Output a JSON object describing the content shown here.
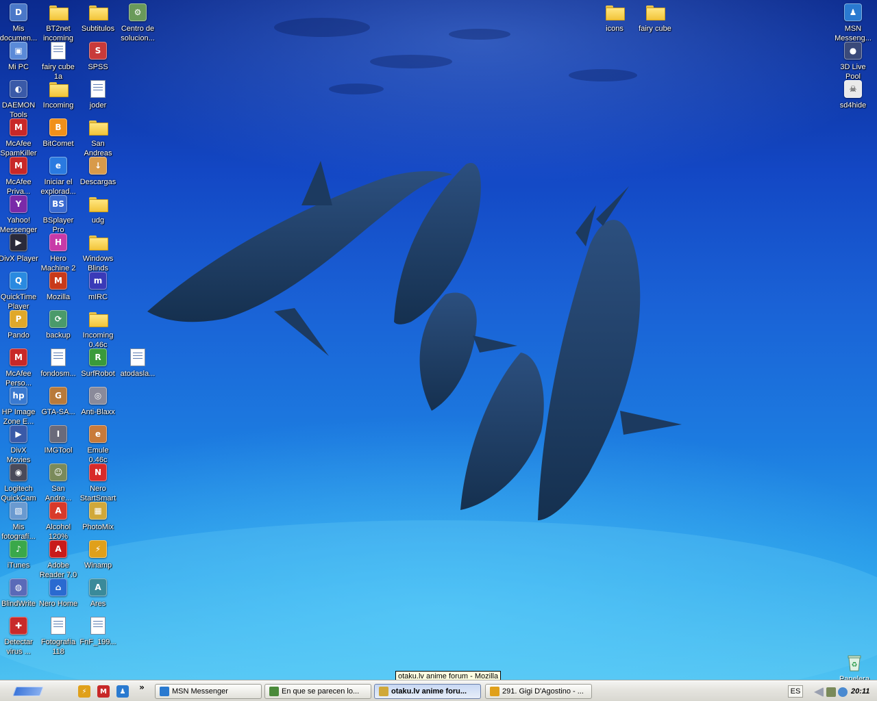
{
  "desktop": {
    "icons": [
      {
        "label": "Mis documen...",
        "kind": "app",
        "color": "#4a78c8",
        "glyph": "D"
      },
      {
        "label": "BT2net incoming",
        "kind": "folder"
      },
      {
        "label": "Subtitulos",
        "kind": "folder"
      },
      {
        "label": "Centro de solucion...",
        "kind": "app",
        "color": "#6a9a5a",
        "glyph": "⚙"
      },
      {
        "label": "Mi PC",
        "kind": "app",
        "color": "#5a8ad8",
        "glyph": "▣"
      },
      {
        "label": "fairy cube 1a",
        "kind": "doc"
      },
      {
        "label": "SPSS",
        "kind": "app",
        "color": "#c83a3a",
        "glyph": "S"
      },
      {
        "label": "DAEMON Tools",
        "kind": "app",
        "color": "#3a5aa8",
        "glyph": "◐"
      },
      {
        "label": "Incoming",
        "kind": "folder"
      },
      {
        "label": "joder",
        "kind": "doc"
      },
      {
        "label": "McAfee SpamKiller",
        "kind": "app",
        "color": "#c82828",
        "glyph": "M"
      },
      {
        "label": "BitComet",
        "kind": "app",
        "color": "#f0901a",
        "glyph": "B"
      },
      {
        "label": "San Andreas",
        "kind": "folder"
      },
      {
        "label": "McAfee Priva...",
        "kind": "app",
        "color": "#c82828",
        "glyph": "M"
      },
      {
        "label": "Iniciar el explorad...",
        "kind": "app",
        "color": "#2a7ae0",
        "glyph": "e"
      },
      {
        "label": "Descargas",
        "kind": "app",
        "color": "#d89a4a",
        "glyph": "↓"
      },
      {
        "label": "Yahoo! Messenger",
        "kind": "app",
        "color": "#7a2aa8",
        "glyph": "Y"
      },
      {
        "label": "BSplayer Pro",
        "kind": "app",
        "color": "#3a6ad0",
        "glyph": "BS"
      },
      {
        "label": "udg",
        "kind": "folder"
      },
      {
        "label": "DivX Player",
        "kind": "app",
        "color": "#2a2a3a",
        "glyph": "▶"
      },
      {
        "label": "Hero Machine 2",
        "kind": "app",
        "color": "#c83aa8",
        "glyph": "H"
      },
      {
        "label": "Windows Blinds",
        "kind": "folder"
      },
      {
        "label": "QuickTime Player",
        "kind": "app",
        "color": "#2a8ae0",
        "glyph": "Q"
      },
      {
        "label": "Mozilla",
        "kind": "app",
        "color": "#c83a1a",
        "glyph": "M"
      },
      {
        "label": "mIRC",
        "kind": "app",
        "color": "#3a3ab8",
        "glyph": "m"
      },
      {
        "label": "Pando",
        "kind": "app",
        "color": "#e0a82a",
        "glyph": "P"
      },
      {
        "label": "backup",
        "kind": "app",
        "color": "#4a9a6a",
        "glyph": "⟳"
      },
      {
        "label": "Incoming 0.46c",
        "kind": "folder"
      },
      {
        "label": "McAfee Perso...",
        "kind": "app",
        "color": "#c82828",
        "glyph": "M"
      },
      {
        "label": "fondosm...",
        "kind": "doc"
      },
      {
        "label": "SurfRobot",
        "kind": "app",
        "color": "#3a9a3a",
        "glyph": "R"
      },
      {
        "label": "atodasla...",
        "kind": "doc"
      },
      {
        "label": "HP Image Zone E...",
        "kind": "app",
        "color": "#3a7ad0",
        "glyph": "hp"
      },
      {
        "label": "GTA-SA...",
        "kind": "app",
        "color": "#b87a3a",
        "glyph": "G"
      },
      {
        "label": "Anti-Blaxx",
        "kind": "app",
        "color": "#8a8a9a",
        "glyph": "◎"
      },
      {
        "label": "DivX Movies",
        "kind": "app",
        "color": "#3a5aa8",
        "glyph": "▶"
      },
      {
        "label": "IMGTool",
        "kind": "app",
        "color": "#6a6a7a",
        "glyph": "I"
      },
      {
        "label": "Emule 0.46c",
        "kind": "app",
        "color": "#c87a3a",
        "glyph": "e"
      },
      {
        "label": "Logitech QuickCam",
        "kind": "app",
        "color": "#4a4a5a",
        "glyph": "◉"
      },
      {
        "label": "San Andre...",
        "kind": "app",
        "color": "#7a8a5a",
        "glyph": "☺"
      },
      {
        "label": "Nero StartSmart",
        "kind": "app",
        "color": "#d82a2a",
        "glyph": "N"
      },
      {
        "label": "Mis fotografí...",
        "kind": "app",
        "color": "#6a9ad0",
        "glyph": "▧"
      },
      {
        "label": "Alcohol 120%",
        "kind": "app",
        "color": "#d83a2a",
        "glyph": "A"
      },
      {
        "label": "PhotoMix",
        "kind": "app",
        "color": "#d0a83a",
        "glyph": "▦"
      },
      {
        "label": "iTunes",
        "kind": "app",
        "color": "#3aa84a",
        "glyph": "♪"
      },
      {
        "label": "Adobe Reader 7.0",
        "kind": "app",
        "color": "#c81a1a",
        "glyph": "A"
      },
      {
        "label": "Winamp",
        "kind": "app",
        "color": "#e0a01a",
        "glyph": "⚡"
      },
      {
        "label": "BlindWrite",
        "kind": "app",
        "color": "#5a6ab8",
        "glyph": "◍"
      },
      {
        "label": "Nero Home",
        "kind": "app",
        "color": "#2a6ad0",
        "glyph": "⌂"
      },
      {
        "label": "Ares",
        "kind": "app",
        "color": "#3a8a9a",
        "glyph": "A"
      },
      {
        "label": "Detectar virus ...",
        "kind": "app",
        "color": "#c82a2a",
        "glyph": "✚"
      },
      {
        "label": "Fotografía 118",
        "kind": "doc"
      },
      {
        "label": "FnF_199...",
        "kind": "doc"
      },
      {
        "label": "icons",
        "kind": "folder"
      },
      {
        "label": "fairy cube",
        "kind": "folder"
      },
      {
        "label": "MSN Messeng...",
        "kind": "app",
        "color": "#2a7ad0",
        "glyph": "♟"
      },
      {
        "label": "3D Live Pool",
        "kind": "app",
        "color": "#3a4a7a",
        "glyph": "●"
      },
      {
        "label": "sd4hide",
        "kind": "app",
        "color": "#eaeaea",
        "glyph": "☠"
      }
    ],
    "recycle_label": "Papelera"
  },
  "tooltip": "otaku.lv anime forum - Mozilla",
  "taskbar": {
    "quick_launch": [
      {
        "name": "winamp-quick",
        "color": "#e0a01a",
        "glyph": "⚡"
      },
      {
        "name": "mcafee-quick",
        "color": "#c82828",
        "glyph": "M"
      },
      {
        "name": "msn-quick",
        "color": "#2a7ad0",
        "glyph": "♟"
      }
    ],
    "chevron": "»",
    "tasks": [
      {
        "label": "MSN Messenger",
        "color": "#2a7ad0",
        "active": false
      },
      {
        "label": "En que se parecen lo...",
        "color": "#4a8a3a",
        "active": false
      },
      {
        "label": "otaku.lv anime foru...",
        "color": "#d0a83a",
        "active": true
      },
      {
        "label": "291. Gigi D'Agostino - ...",
        "color": "#e0a01a",
        "active": false
      }
    ],
    "tray": {
      "lang": "ES",
      "clock": "20:11"
    }
  }
}
